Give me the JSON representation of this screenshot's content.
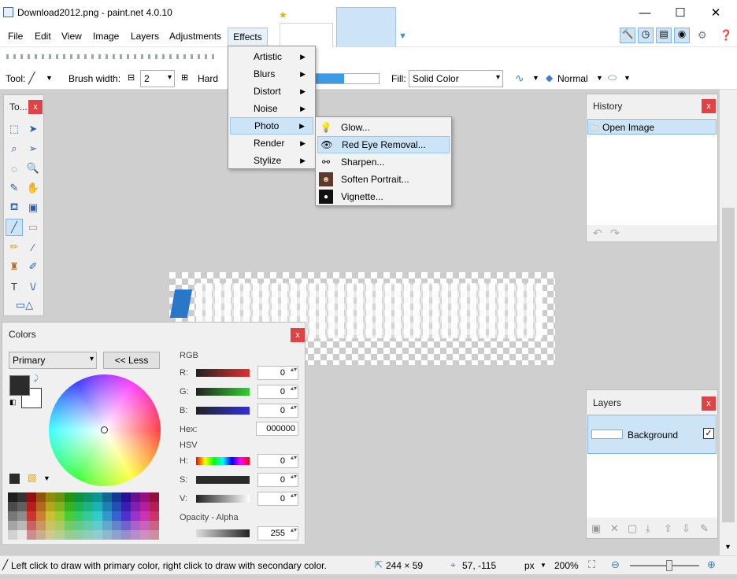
{
  "window": {
    "title": "Download2012.png - paint.net 4.0.10",
    "minimize": "—",
    "maximize": "☐",
    "close": "✕"
  },
  "menu": {
    "items": [
      "File",
      "Edit",
      "View",
      "Image",
      "Layers",
      "Adjustments",
      "Effects"
    ]
  },
  "toolbar": {
    "tool_label": "Tool:",
    "brush_width_label": "Brush width:",
    "brush_width_value": "2",
    "hardness_label": "Hard",
    "fill_label": "Fill:",
    "fill_value": "Solid Color",
    "blend_mode": "Normal"
  },
  "effects_menu": {
    "items": [
      {
        "label": "Artistic",
        "has_submenu": true
      },
      {
        "label": "Blurs",
        "has_submenu": true
      },
      {
        "label": "Distort",
        "has_submenu": true
      },
      {
        "label": "Noise",
        "has_submenu": true
      },
      {
        "label": "Photo",
        "has_submenu": true,
        "highlighted": true
      },
      {
        "label": "Render",
        "has_submenu": true
      },
      {
        "label": "Stylize",
        "has_submenu": true
      }
    ]
  },
  "photo_submenu": {
    "items": [
      {
        "label": "Glow...",
        "icon": "bulb-icon"
      },
      {
        "label": "Red Eye Removal...",
        "icon": "eye-icon",
        "highlighted": true
      },
      {
        "label": "Sharpen...",
        "icon": "glasses-icon"
      },
      {
        "label": "Soften Portrait...",
        "icon": "portrait-icon"
      },
      {
        "label": "Vignette...",
        "icon": "vignette-icon"
      }
    ]
  },
  "tools_panel": {
    "title": "To...",
    "close": "x"
  },
  "history_panel": {
    "title": "History",
    "close": "x",
    "items": [
      "Open Image"
    ],
    "undo": "↶",
    "redo": "↷"
  },
  "layers_panel": {
    "title": "Layers",
    "close": "x",
    "layers": [
      {
        "name": "Background",
        "visible": true
      }
    ]
  },
  "colors_panel": {
    "title": "Colors",
    "close": "x",
    "mode": "Primary",
    "less_button": "<< Less",
    "rgb_label": "RGB",
    "r_label": "R:",
    "r_value": "0",
    "g_label": "G:",
    "g_value": "0",
    "b_label": "B:",
    "b_value": "0",
    "hex_label": "Hex:",
    "hex_value": "000000",
    "hsv_label": "HSV",
    "h_label": "H:",
    "h_value": "0",
    "s_label": "S:",
    "s_value": "0",
    "v_label": "V:",
    "v_value": "0",
    "opacity_label": "Opacity - Alpha",
    "opacity_value": "255"
  },
  "status": {
    "hint": "Left click to draw with primary color, right click to draw with secondary color.",
    "image_size": "244 × 59",
    "cursor_pos": "57, -115",
    "unit": "px",
    "zoom": "200%"
  },
  "colors": {
    "accent": "#cce4f7",
    "close_red": "#e04343",
    "primary_swatch": "#2b2b2b"
  }
}
